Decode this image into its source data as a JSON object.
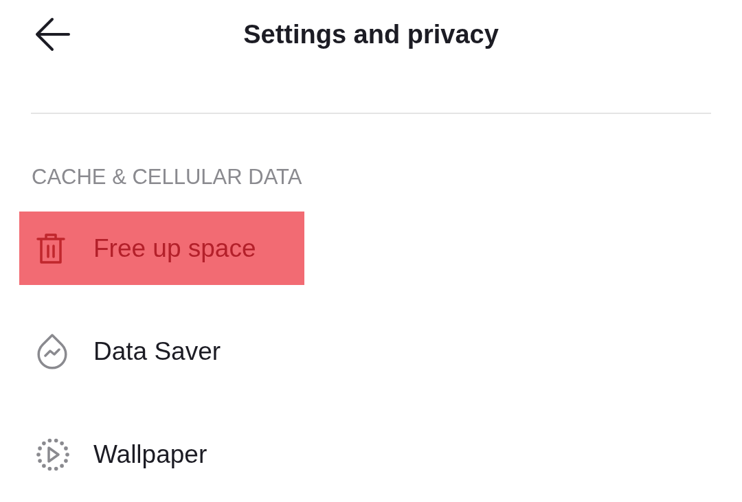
{
  "header": {
    "title": "Settings and privacy"
  },
  "section": {
    "heading": "CACHE & CELLULAR DATA"
  },
  "items": [
    {
      "label": "Free up space",
      "kind": "trash",
      "highlighted": true
    },
    {
      "label": "Data Saver",
      "kind": "drop",
      "highlighted": false
    },
    {
      "label": "Wallpaper",
      "kind": "play",
      "highlighted": false
    }
  ]
}
